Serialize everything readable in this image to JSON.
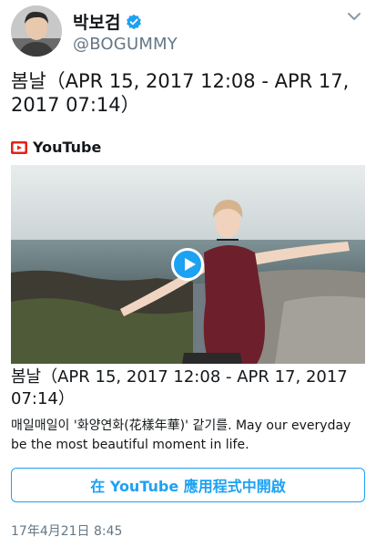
{
  "header": {
    "display_name": "박보검",
    "handle": "@BOGUMMY",
    "verified": true
  },
  "tweet": {
    "text": "봄날（APR 15, 2017 12:08 - APR 17, 2017 07:14）"
  },
  "card": {
    "source_label": "YouTube",
    "title": "봄날（APR 15, 2017 12:08 - APR 17, 2017 07:14）",
    "description": "매일매일이 '화양연화(花樣年華)' 같기를. May our everyday be the most beautiful moment in life.",
    "open_button_label": "在 YouTube 應用程式中開啟"
  },
  "footer": {
    "timestamp": "17年4月21日 8:45"
  },
  "colors": {
    "accent": "#1da1f2",
    "youtube_red": "#e62117",
    "muted": "#657786"
  },
  "icons": [
    "verified-badge-icon",
    "chevron-down-icon",
    "youtube-logo-icon",
    "play-icon"
  ]
}
